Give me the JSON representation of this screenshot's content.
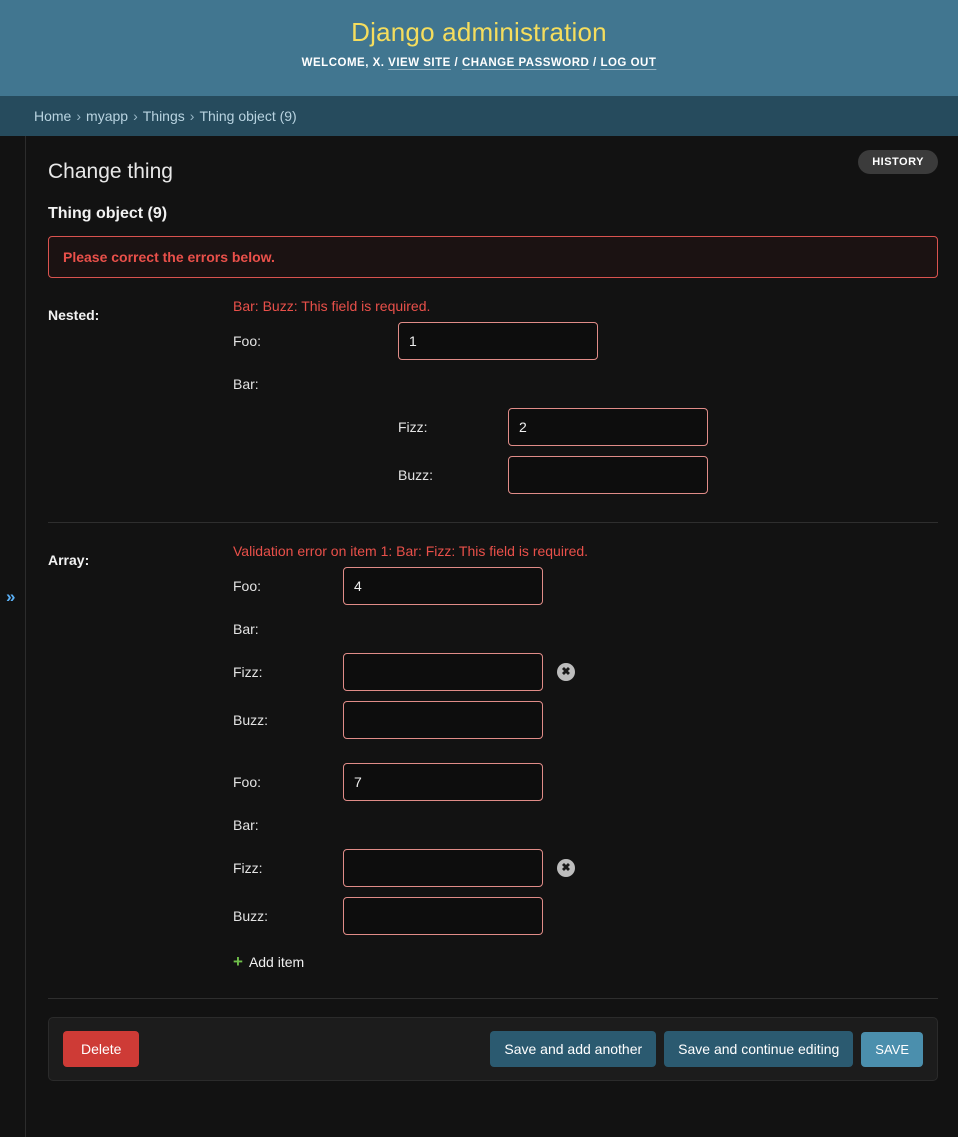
{
  "header": {
    "site_title": "Django administration",
    "welcome_prefix": "WELCOME,",
    "username": "X.",
    "links": [
      {
        "label": "VIEW SITE"
      },
      {
        "label": "CHANGE PASSWORD"
      },
      {
        "label": "LOG OUT"
      }
    ],
    "separator": "/",
    "bg_color": "#417690",
    "title_color": "#f5dd5d"
  },
  "breadcrumbs": {
    "separator": "›",
    "items": [
      {
        "label": "Home"
      },
      {
        "label": "myapp"
      },
      {
        "label": "Things"
      },
      {
        "label": "Thing object (9)"
      }
    ]
  },
  "sidebar": {
    "toggle_icon": "»",
    "toggle_color": "#5bb1f7"
  },
  "page": {
    "title": "Change thing",
    "object_caption": "Thing object (9)",
    "history_label": "HISTORY",
    "errornote": "Please correct the errors below."
  },
  "form": {
    "nested": {
      "label": "Nested:",
      "error": "Bar: Buzz: This field is required.",
      "foo_label": "Foo:",
      "foo_value": "1",
      "bar_label": "Bar:",
      "fizz_label": "Fizz:",
      "fizz_value": "2",
      "buzz_label": "Buzz:",
      "buzz_value": ""
    },
    "array": {
      "label": "Array:",
      "error": "Validation error on item 1: Bar: Fizz: This field is required.",
      "items": [
        {
          "foo_label": "Foo:",
          "foo_value": "4",
          "bar_label": "Bar:",
          "fizz_label": "Fizz:",
          "fizz_value": "",
          "buzz_label": "Buzz:",
          "buzz_value": "",
          "remove_icon": "✖"
        },
        {
          "foo_label": "Foo:",
          "foo_value": "7",
          "bar_label": "Bar:",
          "fizz_label": "Fizz:",
          "fizz_value": "",
          "buzz_label": "Buzz:",
          "buzz_value": "",
          "remove_icon": "✖"
        }
      ],
      "add_item_label": "Add item",
      "add_item_icon": "+"
    }
  },
  "submit_row": {
    "delete_label": "Delete",
    "save_add_another_label": "Save and add another",
    "save_continue_label": "Save and continue editing",
    "save_label": "SAVE",
    "delete_color": "#ce3b36",
    "save_color": "#4b8fad"
  }
}
